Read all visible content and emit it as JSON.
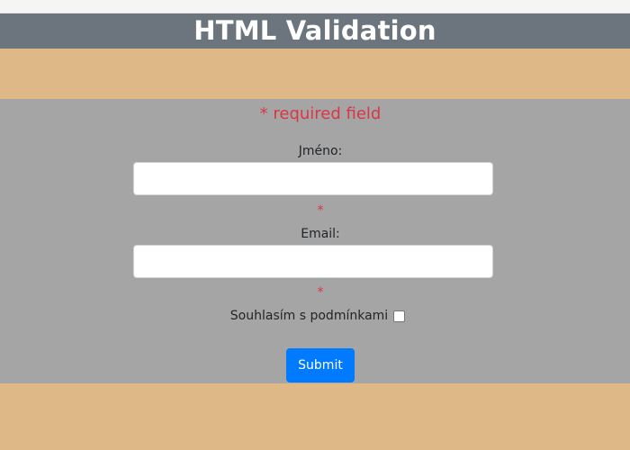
{
  "header": {
    "title": "HTML Validation"
  },
  "form": {
    "required_note": "* required field",
    "name_field": {
      "label": "Jméno:",
      "value": "",
      "required_marker": "*"
    },
    "email_field": {
      "label": "Email:",
      "value": "",
      "required_marker": "*"
    },
    "consent": {
      "label": "Souhlasím s podmínkami",
      "checked": false
    },
    "submit_label": "Submit"
  },
  "colors": {
    "page_background": "#deb887",
    "header_background": "#6c757d",
    "form_background": "#a5a5a5",
    "required_color": "#dc3545",
    "button_color": "#007bff"
  }
}
